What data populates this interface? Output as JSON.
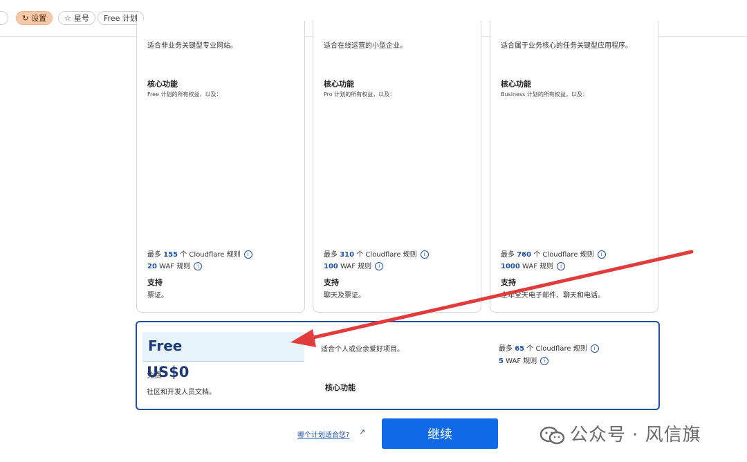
{
  "topbar": {
    "chips": [
      {
        "label": "设置",
        "icon": "refresh-icon"
      },
      {
        "label": "星号",
        "icon": "star-outline-icon"
      },
      {
        "label": "Free 计划"
      }
    ]
  },
  "plans": [
    {
      "desc": "适合非业务关键型专业网站。",
      "core_title": "核心功能",
      "inherit": "Free 计划的所有权益，以及：",
      "rules_prefix": "最多",
      "rules_count": "155",
      "rules_suffix": "个 Cloudflare 规则",
      "waf_count": "20",
      "waf_suffix": "WAF 规则",
      "support_title": "支持",
      "support_text": "票证。"
    },
    {
      "desc": "适合在线运营的小型企业。",
      "core_title": "核心功能",
      "inherit": "Pro 计划的所有权益，以及：",
      "rules_prefix": "最多",
      "rules_count": "310",
      "rules_suffix": "个 Cloudflare 规则",
      "waf_count": "100",
      "waf_suffix": "WAF 规则",
      "support_title": "支持",
      "support_text": "聊天及票证。"
    },
    {
      "desc": "适合属于业务核心的任务关键型应用程序。",
      "core_title": "核心功能",
      "inherit": "Business 计划的所有权益，以及：",
      "rules_prefix": "最多",
      "rules_count": "760",
      "rules_suffix": "个 Cloudflare 规则",
      "waf_count": "1000",
      "waf_suffix": "WAF 规则",
      "support_title": "支持",
      "support_text": "全年全天电子邮件、聊天和电话。"
    }
  ],
  "free_plan": {
    "title": "Free",
    "price": "US$0",
    "price_strike": "免费",
    "price_sub": "社区和开发人员文档。",
    "desc": "适合个人或业余爱好项目。",
    "core_title": "核心功能",
    "rules_prefix": "最多",
    "rules_count": "65",
    "rules_suffix": "个 Cloudflare 规则",
    "waf_count": "5",
    "waf_suffix": "WAF 规则"
  },
  "footer": {
    "which_plan": "哪个计划适合您?",
    "continue_label": "继续"
  },
  "watermark": {
    "text": "公众号 · 风信旗"
  },
  "colors": {
    "accent_blue": "#1069e6",
    "number_blue": "#1a4fb0",
    "free_border": "#1d4fa8",
    "arrow_red": "#e23b3b"
  }
}
